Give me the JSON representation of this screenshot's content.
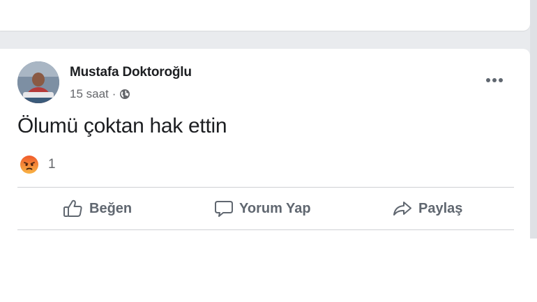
{
  "post": {
    "author": "Mustafa Doktoroğlu",
    "time": "15 saat",
    "separator": "·",
    "text": "Ölumü çoktan hak ettin",
    "reaction": {
      "icon": "angry-reaction-icon",
      "count": "1",
      "color": "#f7714c"
    }
  },
  "actions": {
    "like": "Beğen",
    "comment": "Yorum Yap",
    "share": "Paylaş"
  },
  "colors": {
    "feed_background": "#e9ebee",
    "text_primary": "#1c1e21",
    "text_secondary": "#65676b"
  }
}
